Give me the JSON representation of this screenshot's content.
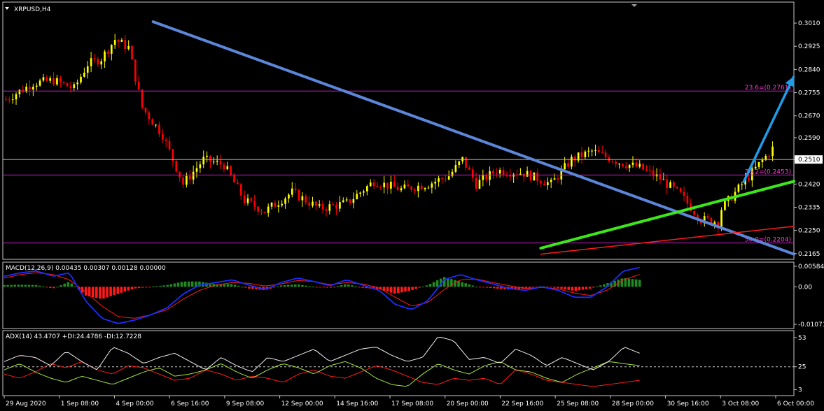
{
  "window_title": "XRPUSD,H4",
  "colors": {
    "background": "#000000",
    "frame": "#c8c8c8",
    "bull_candle": "#ffff00",
    "bear_candle": "#ff0000",
    "fib_line": "#c81ec8",
    "fib_text": "#ff3ad8",
    "current_price_line": "#c8c8c8",
    "downtrend_line": "#5b86d9",
    "support_line": "#3ce81a",
    "red_trendline": "#ff1a1a",
    "arrow": "#1f9be8",
    "macd_line": "#1a2dff",
    "signal_line": "#ff1a1a",
    "hist_pos": "#1f8c1f",
    "hist_neg": "#ff1a1a",
    "adx_line": "#f0f0f0",
    "plus_di": "#a6e63c",
    "minus_di": "#ff1a1a"
  },
  "chart_data": [
    {
      "type": "candlestick",
      "title": "XRPUSD,H4",
      "current_price_label": "0.2510",
      "current_price": 0.251,
      "ylim": [
        0.2144,
        0.3087
      ],
      "y_ticks": [
        "0.3010",
        "0.2925",
        "0.2840",
        "0.2755",
        "0.2670",
        "0.2590",
        "0.2510",
        "0.2420",
        "0.2335",
        "0.2250",
        "0.2165"
      ],
      "x_ticks": [
        "29 Aug 2020",
        "1 Sep 08:00",
        "4 Sep 00:00",
        "6 Sep 16:00",
        "9 Sep 08:00",
        "12 Sep 00:00",
        "14 Sep 16:00",
        "17 Sep 08:00",
        "20 Sep 00:00",
        "22 Sep 16:00",
        "25 Sep 08:00",
        "28 Sep 00:00",
        "30 Sep 16:00",
        "3 Oct 08:00",
        "6 Oct 00:00"
      ],
      "bar_count": 226,
      "anchors": [
        {
          "bar": 0,
          "price": 0.273
        },
        {
          "bar": 8,
          "price": 0.279
        },
        {
          "bar": 14,
          "price": 0.28
        },
        {
          "bar": 20,
          "price": 0.277
        },
        {
          "bar": 24,
          "price": 0.286
        },
        {
          "bar": 28,
          "price": 0.288
        },
        {
          "bar": 32,
          "price": 0.295
        },
        {
          "bar": 36,
          "price": 0.292
        },
        {
          "bar": 40,
          "price": 0.27
        },
        {
          "bar": 46,
          "price": 0.26
        },
        {
          "bar": 52,
          "price": 0.242
        },
        {
          "bar": 58,
          "price": 0.251
        },
        {
          "bar": 64,
          "price": 0.249
        },
        {
          "bar": 70,
          "price": 0.236
        },
        {
          "bar": 76,
          "price": 0.232
        },
        {
          "bar": 84,
          "price": 0.239
        },
        {
          "bar": 92,
          "price": 0.233
        },
        {
          "bar": 100,
          "price": 0.235
        },
        {
          "bar": 108,
          "price": 0.243
        },
        {
          "bar": 116,
          "price": 0.24
        },
        {
          "bar": 124,
          "price": 0.242
        },
        {
          "bar": 130,
          "price": 0.245
        },
        {
          "bar": 134,
          "price": 0.251
        },
        {
          "bar": 138,
          "price": 0.242
        },
        {
          "bar": 144,
          "price": 0.247
        },
        {
          "bar": 152,
          "price": 0.246
        },
        {
          "bar": 160,
          "price": 0.242
        },
        {
          "bar": 166,
          "price": 0.251
        },
        {
          "bar": 172,
          "price": 0.254
        },
        {
          "bar": 180,
          "price": 0.25
        },
        {
          "bar": 186,
          "price": 0.248
        },
        {
          "bar": 192,
          "price": 0.244
        },
        {
          "bar": 198,
          "price": 0.238
        },
        {
          "bar": 204,
          "price": 0.229
        },
        {
          "bar": 210,
          "price": 0.228
        },
        {
          "bar": 216,
          "price": 0.23
        },
        {
          "bar": 220,
          "price": 0.226
        },
        {
          "bar": 226,
          "price": 0.218
        }
      ],
      "fib_levels": [
        {
          "label": "23.6=(0.2761)",
          "price": 0.2761
        },
        {
          "label": "38.2=(0.2453)",
          "price": 0.2453
        },
        {
          "label": "50.0=(0.2204)",
          "price": 0.2204
        }
      ],
      "trendlines": [
        {
          "name": "downtrend",
          "from": {
            "bar": 0.19,
            "price": 0.3015
          },
          "to": {
            "bar": 1.0,
            "price": 0.2163
          }
        },
        {
          "name": "support",
          "from": {
            "bar": 0.68,
            "price": 0.2185
          },
          "to": {
            "bar": 1.0,
            "price": 0.243
          }
        },
        {
          "name": "red",
          "from": {
            "bar": 0.68,
            "price": 0.2163
          },
          "to": {
            "bar": 1.0,
            "price": 0.2265
          }
        }
      ],
      "arrow": {
        "from": {
          "bar": 0.936,
          "price": 0.2425
        },
        "to": {
          "bar": 1.0,
          "price": 0.2815
        }
      }
    },
    {
      "type": "macd",
      "title": "MACD(12,26,9) 0.00435 0.00307 0.00128 0.00000",
      "y_ticks": [
        "0.00584",
        "0.00",
        "-0.01071"
      ],
      "ylim": [
        -0.01071,
        0.00584
      ],
      "macd_anchors": [
        0.003,
        0.004,
        0.0045,
        0.003,
        0.004,
        -0.004,
        -0.009,
        -0.0105,
        -0.0095,
        -0.008,
        -0.006,
        -0.002,
        0.0005,
        0.0012,
        0.002,
        0.0005,
        -0.0008,
        0.0012,
        0.0025,
        0.0015,
        0.0003,
        0.002,
        0.0005,
        -0.001,
        -0.005,
        -0.0065,
        -0.004,
        0.002,
        0.0035,
        0.002,
        0.0008,
        -0.0005,
        -0.001,
        0.0,
        -0.001,
        -0.003,
        -0.003,
        0.0,
        0.0045,
        0.0055
      ],
      "signal_anchors": [
        0.0025,
        0.0035,
        0.004,
        0.0035,
        0.002,
        -0.0015,
        -0.0055,
        -0.0085,
        -0.009,
        -0.008,
        -0.0065,
        -0.0035,
        -0.001,
        0.0005,
        0.0012,
        0.001,
        0.0002,
        0.0008,
        0.0018,
        0.0015,
        0.0006,
        0.0012,
        0.0008,
        -0.0003,
        -0.003,
        -0.0055,
        -0.0045,
        -0.0008,
        0.002,
        0.0022,
        0.0012,
        0.0003,
        -0.0005,
        -0.0002,
        -0.0006,
        -0.0018,
        -0.0025,
        -0.001,
        0.002,
        0.0035
      ],
      "histogram_anchors": [
        0.0005,
        0.0006,
        0.0005,
        -0.0005,
        0.0015,
        -0.0025,
        -0.0035,
        -0.002,
        -0.0005,
        0.0,
        0.0005,
        0.0015,
        0.0015,
        0.0007,
        0.0008,
        -0.0005,
        -0.001,
        0.0004,
        0.0007,
        0.0,
        -0.0003,
        0.0008,
        -0.0003,
        -0.0007,
        -0.002,
        -0.001,
        0.0005,
        0.0028,
        0.0015,
        0.0,
        -0.0004,
        -0.0008,
        -0.0005,
        0.0002,
        -0.0004,
        -0.0012,
        -0.0005,
        0.001,
        0.0025,
        0.002
      ]
    },
    {
      "type": "adx",
      "title": "ADX(14) 43.4707 +DI:24.4786 -DI:12.7228",
      "y_ticks": [
        "53",
        "25",
        "3"
      ],
      "ylim": [
        0,
        57
      ],
      "adx_anchors": [
        30,
        36,
        34,
        26,
        40,
        30,
        22,
        44,
        38,
        28,
        34,
        38,
        30,
        22,
        34,
        26,
        20,
        34,
        30,
        36,
        42,
        30,
        36,
        42,
        44,
        36,
        30,
        34,
        54,
        50,
        32,
        34,
        28,
        42,
        36,
        26,
        34,
        28,
        22,
        30,
        44,
        38
      ],
      "plus_di_anchors": [
        22,
        28,
        20,
        14,
        10,
        16,
        12,
        8,
        14,
        20,
        24,
        16,
        18,
        22,
        28,
        20,
        14,
        22,
        28,
        24,
        18,
        26,
        30,
        24,
        14,
        8,
        6,
        18,
        28,
        22,
        18,
        26,
        30,
        22,
        20,
        14,
        10,
        18,
        24,
        30,
        28,
        26
      ],
      "minus_di_anchors": [
        18,
        14,
        20,
        28,
        24,
        30,
        22,
        18,
        26,
        24,
        18,
        12,
        14,
        22,
        18,
        12,
        16,
        14,
        10,
        18,
        22,
        16,
        14,
        20,
        26,
        22,
        16,
        10,
        8,
        14,
        12,
        14,
        8,
        22,
        18,
        12,
        10,
        8,
        6,
        8,
        10,
        12
      ],
      "dashed_level": 25
    }
  ]
}
